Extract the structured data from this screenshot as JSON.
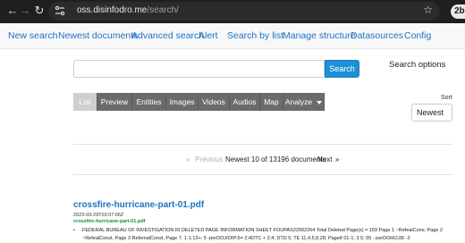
{
  "browser": {
    "url_host": "oss.disinfodro.me",
    "url_path": "/search/",
    "profile_initials": "2b"
  },
  "navbar": {
    "items": [
      "New search",
      "Newest documents",
      "Advanced search",
      "Alert",
      "Search by list",
      "Manage structure",
      "Datasources",
      "Config"
    ]
  },
  "search": {
    "query": "",
    "button_label": "Search",
    "options_label": "Search options"
  },
  "view_tabs": {
    "active": "List",
    "items": [
      "List",
      "Preview",
      "Entities",
      "Images",
      "Videos",
      "Audios",
      "Map",
      "Analyze"
    ]
  },
  "sort": {
    "label": "Sort",
    "selected": "Newest"
  },
  "pager": {
    "previous_label": "Previous",
    "summary": "Newest 10 of 13196 documents",
    "next_label": "Next",
    "next_arrows": "»",
    "prev_arrows": "«"
  },
  "results": [
    {
      "title": "crossfire-hurricane-part-01.pdf",
      "date": "2023-03-29T03:07:06Z",
      "filename": "crossfire-hurricane-part-01.pdf",
      "snippet_lines": [
        "FEDERAL BUREAU OF INVESTIGATION RI DELETED PAGE INFORMATION SHEET FOUPAS22002264 Total Deleted Page(s) = 159 Page 1 ~RefealCons; Page 2",
        "~RefealConst, Page 3 RefemalConst, Page 7. 1-1;13+; 5 -perDOJ/OIP;6= 2;4DTC + 2;4; DTD 5; TE 11,4,5,8,28; Page8 01-1; 3 5; 05 - perDOHO,06 -2"
      ]
    }
  ]
}
